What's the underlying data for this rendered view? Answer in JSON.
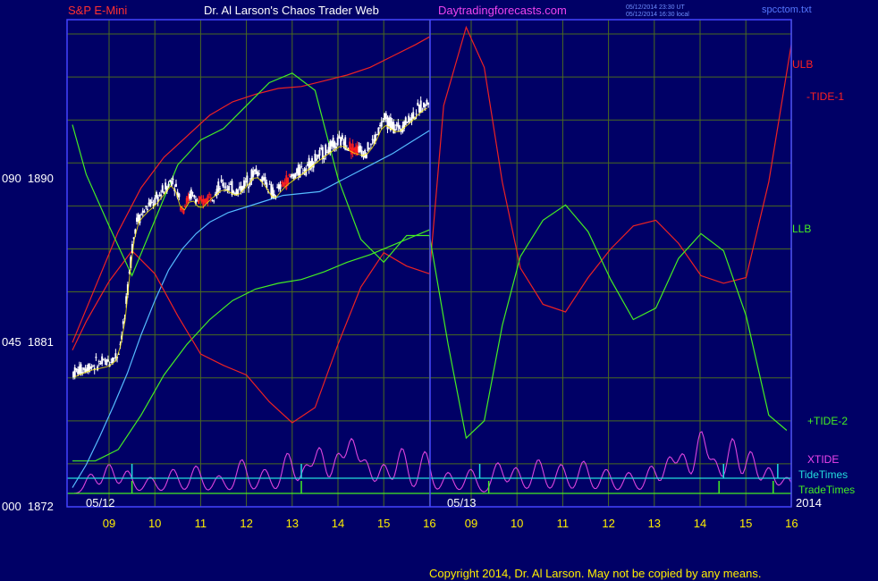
{
  "header": {
    "symbol": "S&P E-Mini",
    "site_title": "Dr. Al Larson's Chaos Trader Web",
    "site_url": "Daytradingforecasts.com",
    "time_ut": "05/12/2014 23:30 UT",
    "time_local": "05/12/2014 16:30 local",
    "filename": "spcctom.txt"
  },
  "copyright": "Copyright 2014, Dr. Al Larson. May not be copied by any means.",
  "colors": {
    "background": "#000066",
    "grid": "#4a6a20",
    "frame": "#4444ff",
    "ulb": "#ee2222",
    "llb": "#44ee22",
    "tide": "#22dddd",
    "xtide": "#dd44dd",
    "price": "#ffffff",
    "down": "#ff2020",
    "ma": "#ffee00",
    "title_red": "#ff3030",
    "title_white": "#ffffff",
    "title_magenta": "#ee44ee"
  },
  "chart_data": {
    "type": "line",
    "title": "S&P E-Mini",
    "y_axis": {
      "ticks": [
        {
          "value": 1890,
          "label": "090  1890"
        },
        {
          "value": 1881,
          "label": "045  1881"
        },
        {
          "value": 1872,
          "label": "000  1872"
        }
      ],
      "range": [
        1872,
        1897.5
      ]
    },
    "x_axis": {
      "range": [
        8.2,
        16.3
      ],
      "hour_labels": [
        "09",
        "10",
        "11",
        "12",
        "13",
        "14",
        "15",
        "16",
        "09",
        "10",
        "11",
        "12",
        "13",
        "14",
        "15",
        "16"
      ],
      "day1_hours": [
        9,
        10,
        11,
        12,
        13,
        14,
        15,
        16
      ],
      "day2_hours": [
        9,
        10,
        11,
        12,
        13,
        14,
        15,
        16
      ],
      "day_separators": [
        {
          "label": "05/12"
        },
        {
          "label": "05/13"
        }
      ],
      "year_label": "2014",
      "grid": true
    },
    "legend": [
      {
        "name": "ULB",
        "color": "#ee2222"
      },
      {
        "name": "-TIDE-1",
        "color": "#ee2222"
      },
      {
        "name": "LLB",
        "color": "#44ee22"
      },
      {
        "name": "+TIDE-2",
        "color": "#44ee22"
      },
      {
        "name": "XTIDE",
        "color": "#dd44dd"
      },
      {
        "name": "TideTimes",
        "color": "#22dddd"
      },
      {
        "name": "TradeTimes",
        "color": "#44ee22"
      }
    ],
    "series": [
      {
        "name": "ULB",
        "day": 1,
        "x": [
          8.2,
          8.7,
          9.2,
          9.7,
          10.2,
          10.7,
          11.2,
          11.7,
          12.2,
          12.7,
          13.2,
          13.7,
          14.2,
          14.7,
          15.2,
          15.7,
          16.0
        ],
        "y": [
          1880.6,
          1883.5,
          1886.4,
          1888.7,
          1890.3,
          1891.4,
          1892.5,
          1893.2,
          1893.6,
          1893.9,
          1894.0,
          1894.3,
          1894.6,
          1895.0,
          1895.6,
          1896.2,
          1896.6
        ]
      },
      {
        "name": "LLB",
        "day": 1,
        "x": [
          8.2,
          8.7,
          9.2,
          9.7,
          10.2,
          10.7,
          11.2,
          11.7,
          12.2,
          12.7,
          13.2,
          13.7,
          14.2,
          14.7,
          15.2,
          15.7,
          16.0
        ],
        "y": [
          1874.4,
          1874.4,
          1875.0,
          1876.8,
          1878.9,
          1880.5,
          1881.8,
          1882.8,
          1883.4,
          1883.7,
          1883.9,
          1884.3,
          1884.8,
          1885.2,
          1885.7,
          1886.2,
          1886.5
        ]
      },
      {
        "name": "MA",
        "day": 1,
        "x": [
          8.2,
          8.5,
          8.8,
          9.1,
          9.4,
          9.7,
          10.0,
          10.3,
          10.6,
          10.9,
          11.2,
          11.6,
          12.0,
          12.4,
          12.8,
          13.2,
          13.6,
          14.0,
          14.4,
          14.8,
          15.2,
          15.6,
          16.0
        ],
        "y": [
          1873.0,
          1874.2,
          1875.7,
          1877.3,
          1879.0,
          1881.0,
          1882.8,
          1884.4,
          1885.5,
          1886.3,
          1886.9,
          1887.4,
          1887.7,
          1888.0,
          1888.3,
          1888.4,
          1888.5,
          1889.0,
          1889.5,
          1890.0,
          1890.5,
          1891.1,
          1891.7
        ]
      },
      {
        "name": "-TIDE-1",
        "day": 1,
        "x": [
          8.2,
          8.5,
          9.0,
          9.5,
          10.0,
          10.5,
          11.0,
          11.5,
          12.0,
          12.5,
          13.0,
          13.5,
          14.0,
          14.5,
          15.0,
          15.5,
          16.0
        ],
        "y": [
          1880.2,
          1881.7,
          1883.8,
          1885.4,
          1884.2,
          1882.0,
          1880.0,
          1879.4,
          1878.9,
          1877.5,
          1876.4,
          1877.2,
          1880.5,
          1883.5,
          1885.3,
          1884.6,
          1884.2
        ]
      },
      {
        "name": "-TIDE-1",
        "day": 2,
        "x": [
          16.0,
          16.3,
          16.8,
          17.2,
          17.6,
          18.0,
          18.5,
          19.0,
          19.5,
          20.0,
          20.5,
          21.0,
          21.5,
          22.0,
          22.5,
          23.0,
          23.5,
          24.0
        ],
        "y": [
          1884.2,
          1893.0,
          1897.1,
          1895.0,
          1889.0,
          1884.5,
          1882.6,
          1882.2,
          1884.0,
          1885.5,
          1886.7,
          1887.0,
          1885.8,
          1884.1,
          1883.7,
          1884.0,
          1889.0,
          1896.2
        ]
      },
      {
        "name": "+TIDE-2",
        "day": 1,
        "x": [
          8.2,
          8.5,
          9.0,
          9.5,
          10.0,
          10.5,
          11.0,
          11.5,
          12.0,
          12.5,
          13.0,
          13.5,
          14.0,
          14.5,
          15.0,
          15.5,
          16.0
        ],
        "y": [
          1892.0,
          1889.4,
          1886.7,
          1884.1,
          1887.0,
          1889.9,
          1891.2,
          1891.8,
          1893.0,
          1894.2,
          1894.7,
          1893.8,
          1889.2,
          1886.0,
          1884.8,
          1886.2,
          1886.2
        ]
      },
      {
        "name": "+TIDE-2",
        "day": 2,
        "x": [
          16.0,
          16.4,
          16.8,
          17.2,
          17.6,
          18.0,
          18.5,
          19.0,
          19.5,
          20.0,
          20.5,
          21.0,
          21.5,
          22.0,
          22.5,
          23.0,
          23.5,
          23.9
        ],
        "y": [
          1886.2,
          1880.5,
          1875.6,
          1876.5,
          1881.5,
          1885.1,
          1887.0,
          1887.8,
          1886.4,
          1883.9,
          1881.8,
          1882.4,
          1885.0,
          1886.3,
          1885.4,
          1882.0,
          1876.8,
          1876.0
        ]
      }
    ],
    "xtide_peak_hours": [
      8.6,
      9.0,
      9.4,
      9.9,
      10.4,
      10.9,
      11.4,
      11.9,
      12.4,
      12.9,
      13.3,
      13.6,
      14.0,
      14.3,
      14.6,
      15.0,
      15.4,
      15.9,
      16.4,
      16.9,
      17.5,
      17.9,
      18.4,
      18.9,
      19.4,
      19.9,
      20.4,
      20.9,
      21.3,
      21.6,
      22.0,
      22.3,
      22.7,
      23.1,
      23.5,
      23.9
    ],
    "xtide_peak_heights": [
      1.2,
      1.8,
      1.4,
      1.0,
      1.5,
      1.7,
      1.1,
      2.1,
      1.5,
      2.5,
      1.7,
      2.8,
      2.4,
      3.3,
      2.0,
      1.8,
      2.8,
      2.6,
      1.3,
      1.5,
      1.9,
      1.6,
      2.1,
      1.8,
      2.0,
      1.5,
      1.3,
      1.7,
      2.2,
      2.4,
      3.8,
      2.0,
      3.4,
      2.6,
      1.6,
      1.0
    ],
    "tide_times": [
      9.5,
      13.2,
      17.1,
      22.5,
      23.7
    ],
    "trade_times": [
      9.5,
      13.2,
      17.3,
      22.4,
      23.6
    ]
  }
}
